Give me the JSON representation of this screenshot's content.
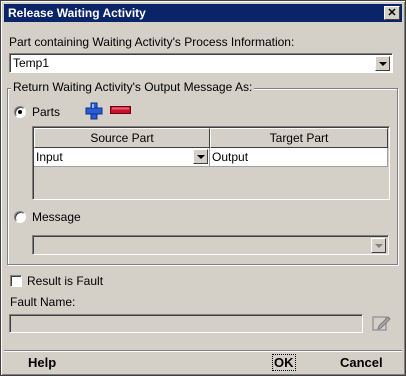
{
  "window": {
    "title": "Release Waiting Activity",
    "close_glyph": "✕"
  },
  "process_part": {
    "label": "Part containing Waiting Activity's Process Information:",
    "value": "Temp1"
  },
  "output_group": {
    "label": "Return Waiting Activity's Output Message As:",
    "parts_option": {
      "label": "Parts",
      "selected": true
    },
    "add_icon": "plus-icon",
    "remove_icon": "minus-icon",
    "table": {
      "columns": [
        "Source Part",
        "Target Part"
      ],
      "rows": [
        {
          "source": "Input",
          "target": "Output"
        }
      ]
    },
    "message_option": {
      "label": "Message",
      "selected": false
    },
    "message_value": ""
  },
  "fault": {
    "checkbox_label": "Result is Fault",
    "checked": false,
    "name_label": "Fault Name:",
    "name_value": ""
  },
  "footer": {
    "help": "Help",
    "ok": "OK",
    "cancel": "Cancel"
  },
  "colors": {
    "titlebar": "#0a246a",
    "face": "#d4d0c8",
    "add_icon": "#2a5bd7",
    "remove_icon": "#c8102e"
  }
}
